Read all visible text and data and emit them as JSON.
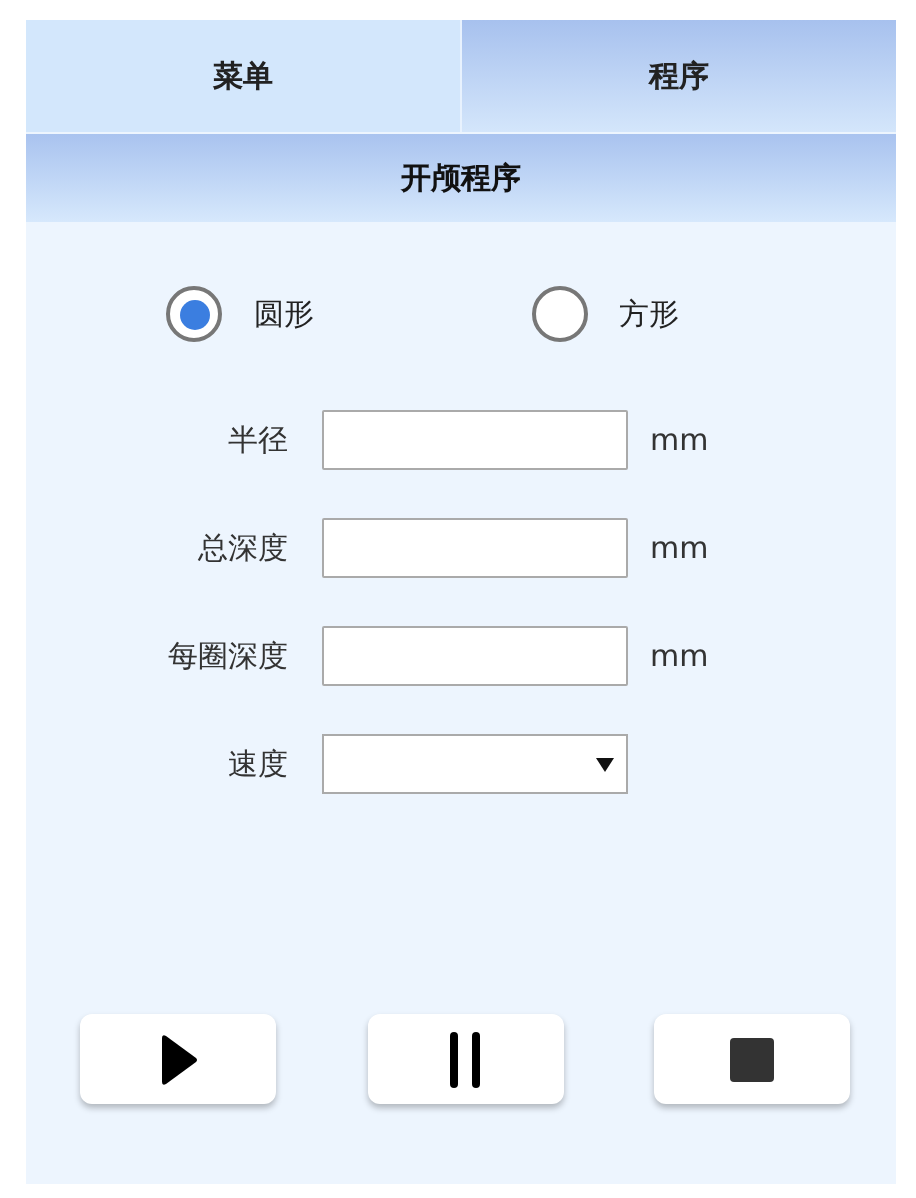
{
  "tabs": [
    {
      "label": "菜单",
      "selected": false
    },
    {
      "label": "程序",
      "selected": true
    }
  ],
  "title": "开颅程序",
  "shapes": [
    {
      "label": "圆形",
      "selected": true
    },
    {
      "label": "方形",
      "selected": false
    }
  ],
  "fields": [
    {
      "kind": "input",
      "label": "半径",
      "unit": "mm"
    },
    {
      "kind": "input",
      "label": "总深度",
      "unit": "mm"
    },
    {
      "kind": "input",
      "label": "每圈深度",
      "unit": "mm"
    },
    {
      "kind": "select",
      "label": "速度"
    }
  ],
  "buttons": [
    {
      "kind": "play"
    },
    {
      "kind": "pause"
    },
    {
      "kind": "stop"
    }
  ]
}
